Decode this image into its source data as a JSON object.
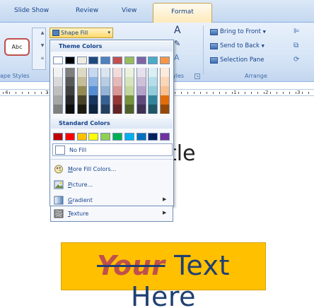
{
  "ribbon": {
    "tabs": [
      {
        "label": "Slide Show"
      },
      {
        "label": "Review"
      },
      {
        "label": "View"
      }
    ],
    "active_tab": "Format",
    "shape_styles": {
      "sample_label": "Abc",
      "group_label": "ape Styles"
    },
    "shape_fill": {
      "label": "Shape Fill"
    },
    "quick_styles_label": "yles",
    "arrange": {
      "items": [
        {
          "label": "Bring to Front"
        },
        {
          "label": "Send to Back"
        },
        {
          "label": "Selection Pane"
        }
      ],
      "group_label": "Arrange"
    }
  },
  "ruler": {
    "left_numbers": [
      "4",
      "3"
    ],
    "right_numbers": [
      "1",
      "2",
      "3"
    ]
  },
  "dropdown": {
    "theme_header": "Theme Colors",
    "standard_header": "Standard Colors",
    "theme_colors": [
      [
        "#ffffff",
        "#f2f2f2",
        "#d9d9d9",
        "#bfbfbf",
        "#a6a6a6",
        "#808080"
      ],
      [
        "#000000",
        "#7f7f7f",
        "#595959",
        "#404040",
        "#262626",
        "#0d0d0d"
      ],
      [
        "#eeece1",
        "#ddd9c3",
        "#c4bd97",
        "#938953",
        "#494429",
        "#1d1b10"
      ],
      [
        "#1f497d",
        "#c6d9f0",
        "#8db3e2",
        "#548dd4",
        "#17365d",
        "#0f243e"
      ],
      [
        "#4f81bd",
        "#dbe5f1",
        "#b8cce4",
        "#95b3d7",
        "#366092",
        "#244061"
      ],
      [
        "#c0504d",
        "#f2dcdb",
        "#e5b9b7",
        "#d99694",
        "#953734",
        "#632423"
      ],
      [
        "#9bbb59",
        "#ebf1dd",
        "#d7e3bc",
        "#c3d69b",
        "#76923c",
        "#4f6128"
      ],
      [
        "#8064a2",
        "#e5e0ec",
        "#ccc1d9",
        "#b2a2c7",
        "#5f497a",
        "#3f3151"
      ],
      [
        "#4bacc6",
        "#dbeef3",
        "#b7dde8",
        "#92cddc",
        "#31859b",
        "#205867"
      ],
      [
        "#f79646",
        "#fdeada",
        "#fbd5b5",
        "#fac08f",
        "#e36c09",
        "#974806"
      ]
    ],
    "standard_colors": [
      "#c00000",
      "#ff0000",
      "#ffc000",
      "#ffff00",
      "#92d050",
      "#00b050",
      "#00b0f0",
      "#0070c0",
      "#002060",
      "#7030a0"
    ],
    "no_fill": "No Fill",
    "menu": [
      {
        "label": "More Fill Colors...",
        "icon": "palette-icon",
        "submenu": false
      },
      {
        "label": "Picture...",
        "icon": "picture-icon",
        "submenu": false
      },
      {
        "label": "Gradient",
        "icon": "gradient-icon",
        "submenu": true
      },
      {
        "label": "Texture",
        "icon": "texture-icon",
        "submenu": true
      }
    ]
  },
  "slide": {
    "title_fragment": "tle",
    "banner": {
      "struck_word": "Your",
      "rest": " Text Here",
      "fill_color": "#ffc000"
    }
  }
}
